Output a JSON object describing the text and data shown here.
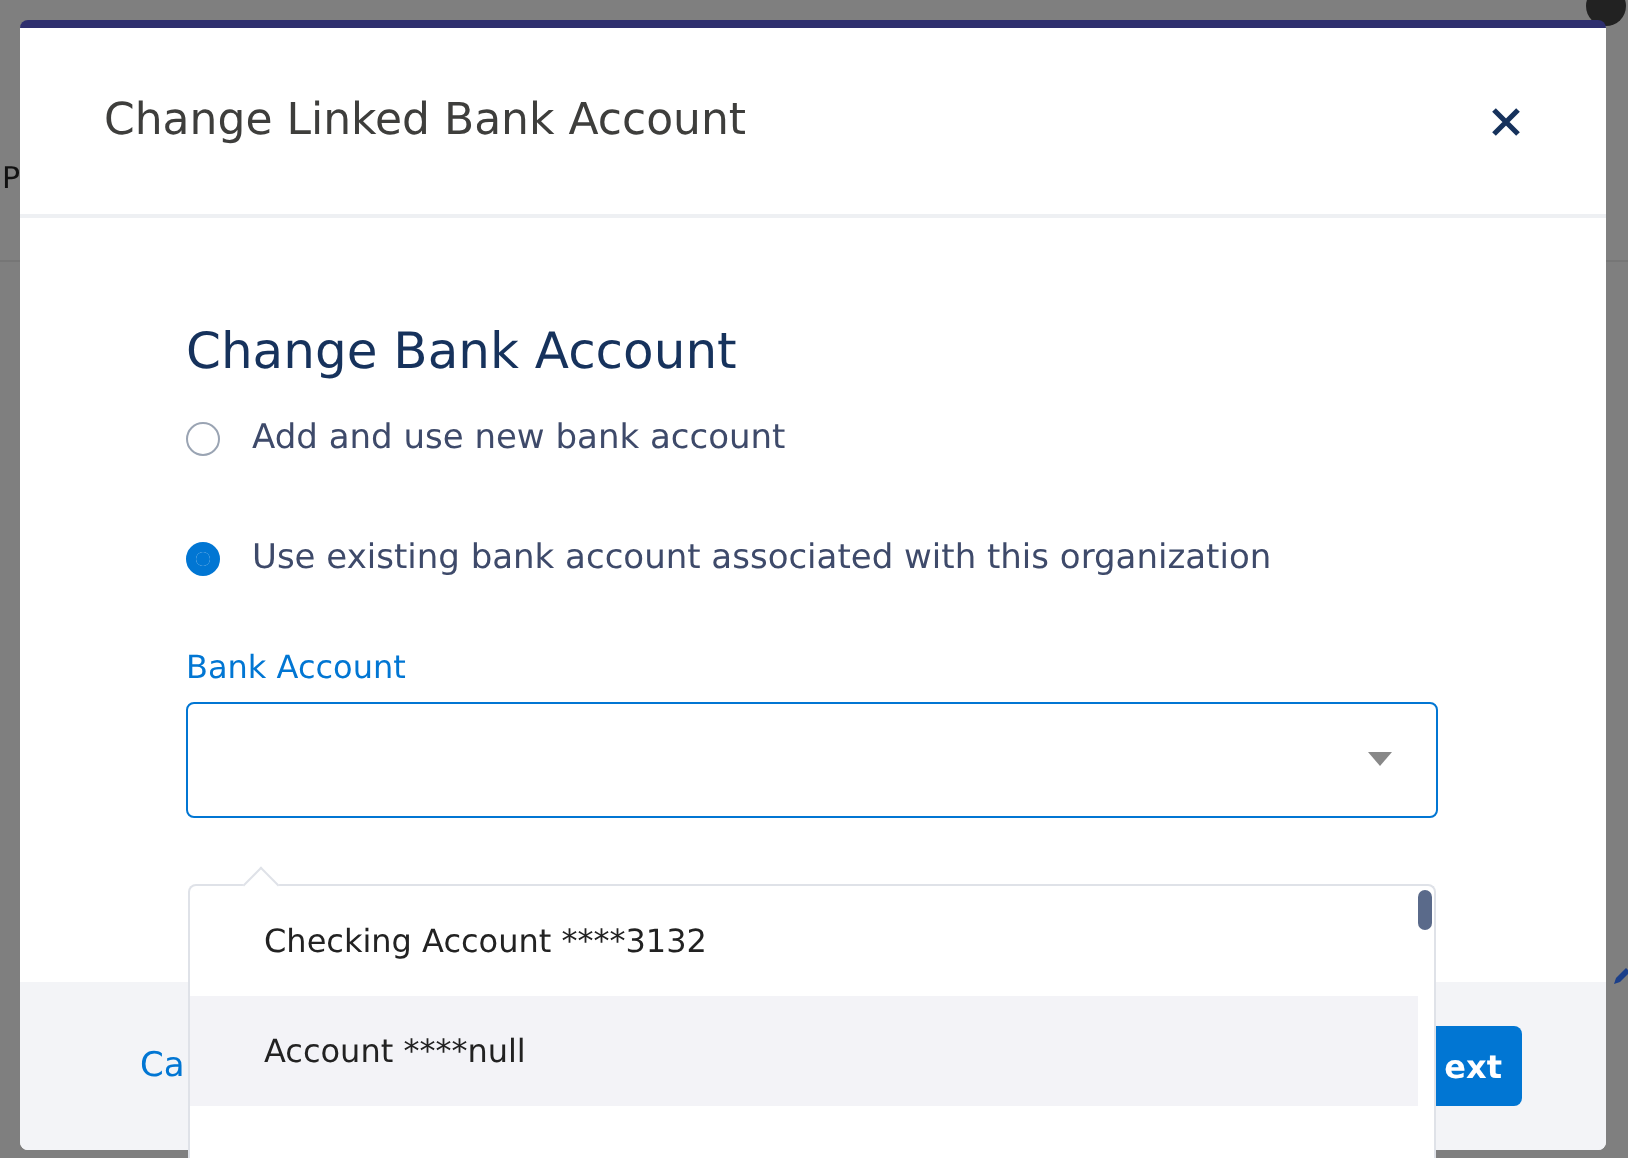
{
  "background": {
    "left_text": "P"
  },
  "window": {
    "title": "Change Linked Bank Account"
  },
  "section_title": "Change Bank Account",
  "options": [
    {
      "label": "Add and use new bank account",
      "selected": false
    },
    {
      "label": "Use existing bank account associated with this organization",
      "selected": true
    }
  ],
  "bank_account": {
    "label": "Bank Account",
    "items": [
      {
        "label": "Checking Account ****3132",
        "hovered": false
      },
      {
        "label": "Account ****null",
        "hovered": true
      }
    ]
  },
  "footer": {
    "cancel": "Ca",
    "next": "ext"
  }
}
